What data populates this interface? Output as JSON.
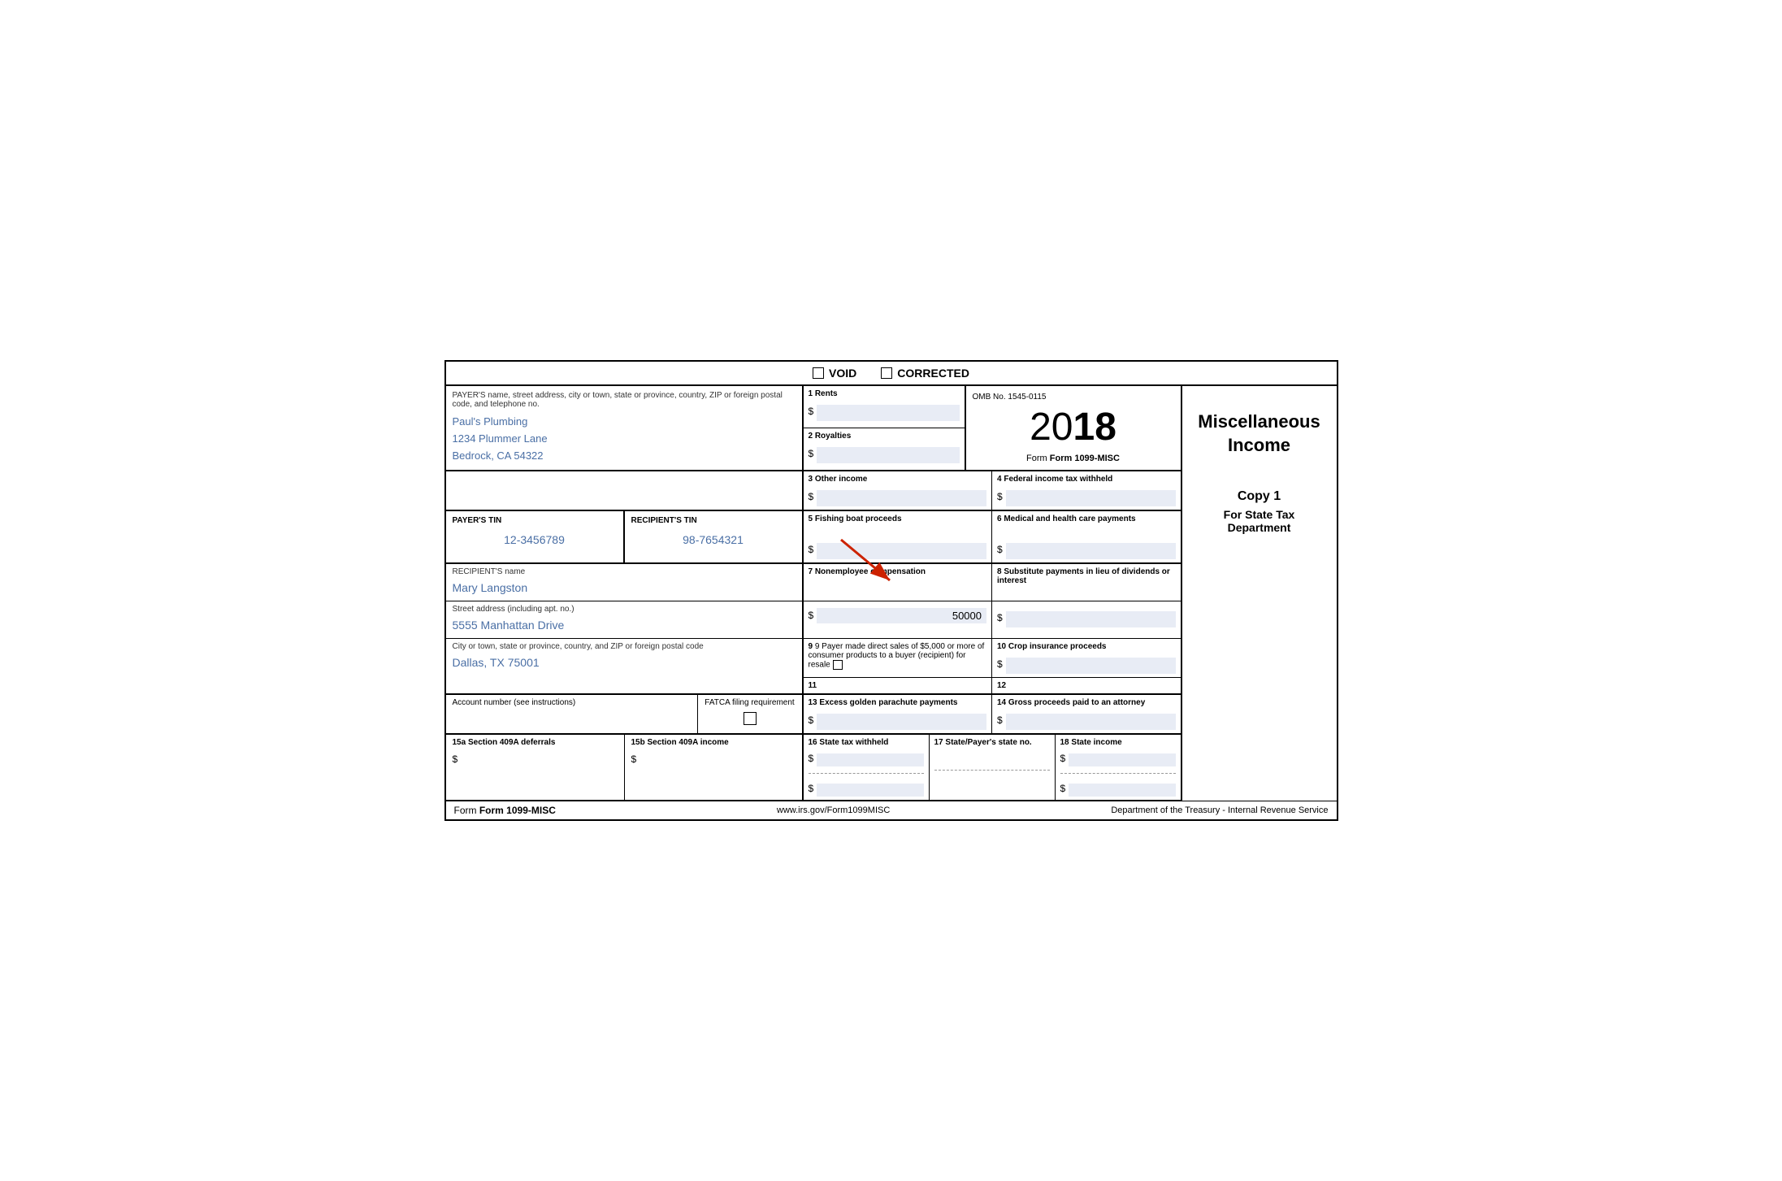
{
  "header": {
    "void_label": "VOID",
    "corrected_label": "CORRECTED"
  },
  "payer": {
    "label": "PAYER'S name, street address, city or town, state or province, country, ZIP or foreign postal code, and telephone no.",
    "name": "Paul's Plumbing",
    "address": "1234 Plummer Lane",
    "city_state": "Bedrock, CA 54322"
  },
  "boxes": {
    "box1_label": "1 Rents",
    "box1_value": "",
    "box2_label": "2 Royalties",
    "box2_value": "",
    "box3_label": "3 Other income",
    "box3_value": "",
    "box4_label": "4 Federal income tax withheld",
    "box4_value": "",
    "box5_label": "5 Fishing boat proceeds",
    "box5_value": "",
    "box6_label": "6 Medical and health care payments",
    "box6_value": "",
    "box7_label": "7 Nonemployee compensation",
    "box7_value": "50000",
    "box8_label": "8 Substitute payments in lieu of dividends or interest",
    "box8_value": "",
    "box9_label": "9 Payer made direct sales of $5,000 or more of consumer products to a buyer (recipient) for resale",
    "box10_label": "10 Crop insurance proceeds",
    "box10_value": "",
    "box11_label": "11",
    "box12_label": "12",
    "box13_label": "13 Excess golden parachute payments",
    "box13_value": "",
    "box14_label": "14 Gross proceeds paid to an attorney",
    "box14_value": "",
    "box15a_label": "15a Section 409A deferrals",
    "box15a_value": "",
    "box15b_label": "15b Section 409A income",
    "box15b_value": "",
    "box16_label": "16 State tax withheld",
    "box16_value1": "",
    "box16_value2": "",
    "box17_label": "17 State/Payer's state no.",
    "box17_value1": "",
    "box17_value2": "",
    "box18_label": "18 State income",
    "box18_value1": "",
    "box18_value2": ""
  },
  "omb": {
    "text": "OMB No. 1545-0115"
  },
  "year": {
    "thin": "20",
    "bold": "18"
  },
  "form_name": "Form 1099-MISC",
  "misc_income": "Miscellaneous\nIncome",
  "copy": {
    "number": "Copy 1",
    "description": "For State Tax Department"
  },
  "payer_tin": {
    "label": "PAYER'S TIN",
    "value": "12-3456789"
  },
  "recipient_tin": {
    "label": "RECIPIENT'S TIN",
    "value": "98-7654321"
  },
  "recipient": {
    "label": "RECIPIENT'S name",
    "name": "Mary Langston"
  },
  "street": {
    "label": "Street address (including apt. no.)",
    "value": "5555 Manhattan Drive"
  },
  "city": {
    "label": "City or town, state or province, country, and ZIP or foreign postal code",
    "value": "Dallas, TX 75001"
  },
  "account": {
    "label": "Account number (see instructions)"
  },
  "fatca": {
    "label": "FATCA filing requirement"
  },
  "footer": {
    "form": "Form 1099-MISC",
    "url": "www.irs.gov/Form1099MISC",
    "dept": "Department of the Treasury - Internal Revenue Service"
  }
}
